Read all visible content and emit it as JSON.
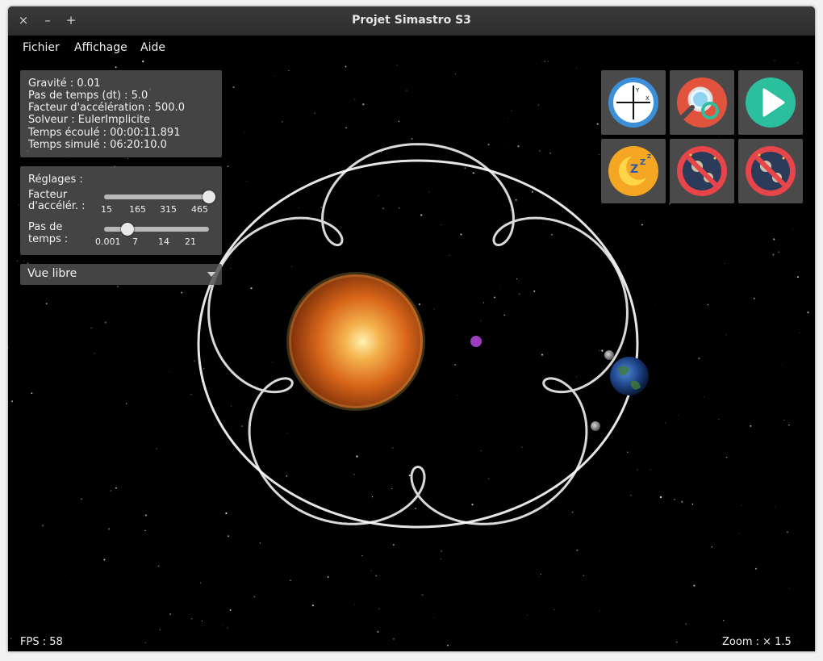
{
  "window": {
    "title": "Projet Simastro S3",
    "close_label": "×",
    "minimize_label": "–",
    "maximize_label": "+"
  },
  "menu": [
    "Fichier",
    "Affichage",
    "Aide"
  ],
  "info": {
    "gravity": "Gravité : 0.01",
    "timestep": "Pas de temps (dt) : 5.0",
    "acceleration": "Facteur d'accélération : 500.0",
    "solver": "Solveur : EulerImplicite",
    "elapsed": "Temps écoulé : 00:00:11.891",
    "simulated": "Temps simulé : 06:20:10.0"
  },
  "settings": {
    "title": "Réglages :",
    "accel_label_1": "Facteur",
    "accel_label_2": "d'accélér. :",
    "accel_ticks": [
      "15",
      "165",
      "315",
      "465"
    ],
    "accel_value_fraction": 1.0,
    "dt_label_1": "Pas de",
    "dt_label_2": "temps :",
    "dt_ticks": [
      "0.001",
      "7",
      "14",
      "21"
    ],
    "dt_value_fraction": 0.22
  },
  "view_select": {
    "selected": "Vue libre"
  },
  "toolbar": [
    {
      "name": "axes-button",
      "icon": "axes-icon",
      "color": "#3b8fd9"
    },
    {
      "name": "search-button",
      "icon": "magnifier-icon",
      "color": "#e2533e"
    },
    {
      "name": "play-button",
      "icon": "play-icon",
      "color": "#2bbf9e"
    },
    {
      "name": "sleep-button",
      "icon": "moon-sleep-icon",
      "color": "#f5a623"
    },
    {
      "name": "no-collision-button",
      "icon": "no-meteor-icon",
      "color": "#e8454b"
    },
    {
      "name": "no-collision-button-2",
      "icon": "no-meteor-icon",
      "color": "#e8454b"
    }
  ],
  "status": {
    "fps": "FPS : 58",
    "zoom": "Zoom : × 1.5"
  },
  "colors": {
    "sun": "#e07a1c",
    "earth": "#1f4f9a",
    "center_marker": "#9b3fbf",
    "orbit": "#ffffff"
  }
}
